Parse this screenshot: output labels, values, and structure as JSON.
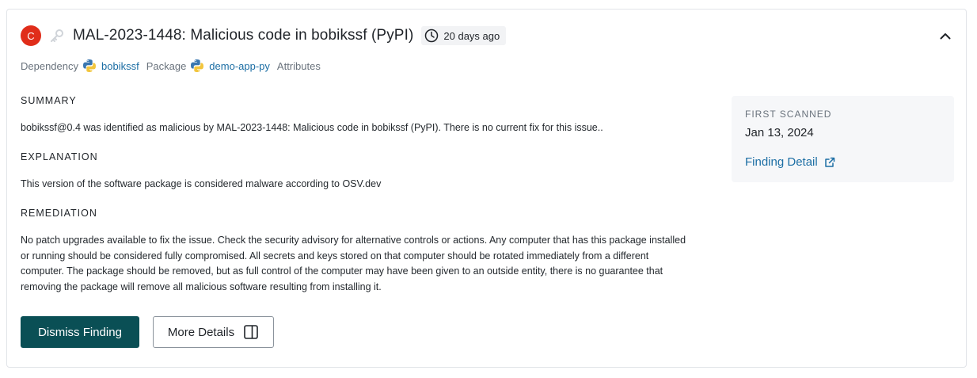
{
  "finding": {
    "severity_letter": "C",
    "title": "MAL-2023-1448: Malicious code in bobikssf (PyPI)",
    "age": "20 days ago"
  },
  "meta": {
    "dependency_label": "Dependency",
    "dependency_value": "bobikssf",
    "package_label": "Package",
    "package_value": "demo-app-py",
    "attributes_label": "Attributes"
  },
  "summary": {
    "heading": "SUMMARY",
    "text": "bobikssf@0.4 was identified as malicious by MAL-2023-1448: Malicious code in bobikssf (PyPI). There is no current fix for this issue.."
  },
  "explanation": {
    "heading": "EXPLANATION",
    "text": "This version of the software package is considered malware according to OSV.dev"
  },
  "remediation": {
    "heading": "REMEDIATION",
    "text": "No patch upgrades available to fix the issue. Check the security advisory for alternative controls or actions. Any computer that has this package installed or running should be considered fully compromised. All secrets and keys stored on that computer should be rotated immediately from a different computer. The package should be removed, but as full control of the computer may have been given to an outside entity, there is no guarantee that removing the package will remove all malicious software resulting from installing it."
  },
  "sidebar": {
    "first_scanned_label": "FIRST SCANNED",
    "first_scanned_value": "Jan 13, 2024",
    "finding_detail_link": "Finding Detail"
  },
  "actions": {
    "dismiss_label": "Dismiss Finding",
    "more_details_label": "More Details"
  },
  "colors": {
    "severity_critical": "#e02d1a",
    "primary_button": "#0a4f55",
    "link": "#1c6ea4"
  },
  "icons": {
    "key": "key-icon",
    "clock": "clock-icon",
    "collapse": "chevron-up-icon",
    "python": "python-logo-icon",
    "external": "external-link-icon",
    "panel": "side-panel-icon"
  }
}
